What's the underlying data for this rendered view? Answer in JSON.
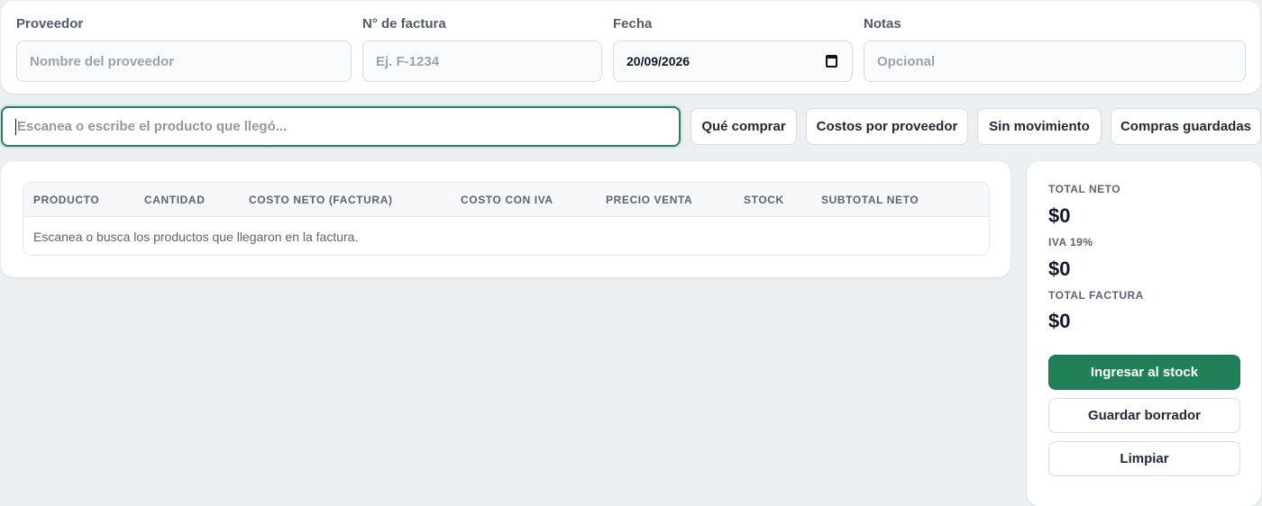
{
  "header": {
    "supplier": {
      "label": "Proveedor",
      "placeholder": "Nombre del proveedor"
    },
    "invoice": {
      "label": "N° de factura",
      "placeholder": "Ej. F-1234"
    },
    "date": {
      "label": "Fecha",
      "value": "20/09/2026"
    },
    "notes": {
      "label": "Notas",
      "placeholder": "Opcional"
    }
  },
  "search": {
    "placeholder": "Escanea o escribe el producto que llegó..."
  },
  "actions": {
    "what_to_buy": "Qué comprar",
    "costs_by_supplier": "Costos por proveedor",
    "no_movement": "Sin movimiento",
    "saved_purchases": "Compras guardadas"
  },
  "table": {
    "columns": [
      "PRODUCTO",
      "CANTIDAD",
      "COSTO NETO (FACTURA)",
      "COSTO CON IVA",
      "PRECIO VENTA",
      "STOCK",
      "SUBTOTAL NETO"
    ],
    "empty_message": "Escanea o busca los productos que llegaron en la factura."
  },
  "totals": {
    "net_label": "TOTAL NETO",
    "net_value": "$0",
    "vat_label": "IVA 19%",
    "vat_value": "$0",
    "invoice_label": "TOTAL FACTURA",
    "invoice_value": "$0",
    "submit_button": "Ingresar al stock",
    "save_draft_button": "Guardar borrador",
    "clear_button": "Limpiar"
  },
  "colors": {
    "accent": "#228059",
    "background": "#edf0f2"
  }
}
